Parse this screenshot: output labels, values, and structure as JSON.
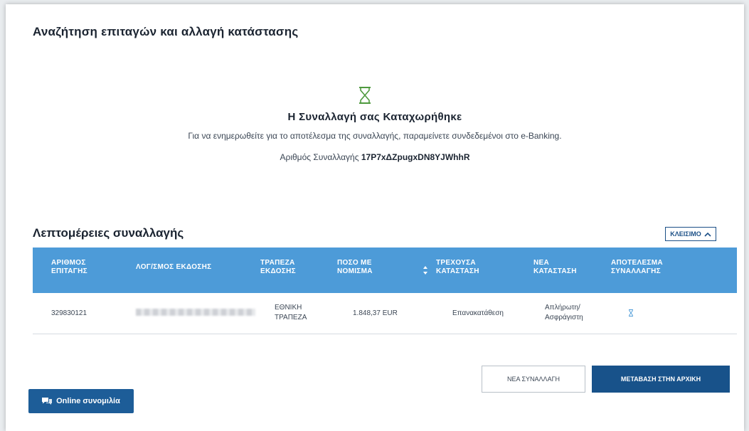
{
  "page": {
    "title": "Αναζήτηση επιταγών και αλλαγή κατάστασης"
  },
  "status": {
    "icon": "hourglass-icon",
    "heading": "Η Συναλλαγή σας Καταχωρήθηκε",
    "message": "Για να ενημερωθείτε για το αποτέλεσμα της συναλλαγής, παραμείνετε συνδεδεμένοι στο e-Banking.",
    "txn_label": "Αριθμός Συναλλαγής",
    "txn_id": "17P7xΔZpugxDN8YJWhhR",
    "accent_color": "#4f9a3f"
  },
  "details": {
    "title": "Λεπτομέρειες συναλλαγής",
    "close_label": "ΚΛΕΙΣΙΜΟ",
    "columns": [
      "ΑΡΙΘΜΟΣ ΕΠΙΤΑΓΗΣ",
      "ΛΟΓ/ΣΜΟΣ ΕΚΔΟΣΗΣ",
      "ΤΡΑΠΕΖΑ ΕΚΔΟΣΗΣ",
      "ΠΟΣΟ ΜΕ ΝΟΜΙΣΜΑ",
      "ΤΡΕΧΟΥΣΑ ΚΑΤΑΣΤΑΣΗ",
      "ΝΕΑ ΚΑΤΑΣΤΑΣΗ",
      "ΑΠΟΤΕΛΕΣΜΑ ΣΥΝΑΛΛΑΓΗΣ"
    ],
    "row": {
      "cheque_number": "329830121",
      "bank": "ΕΘΝΙΚΗ ΤΡΑΠΕΖΑ",
      "amount": "1.848,37 EUR",
      "current_status": "Επανακατάθεση",
      "new_status": "Απλήρωτη/ Ασφράγιστη",
      "result_icon": "hourglass-icon"
    },
    "header_color": "#4d9bd8"
  },
  "actions": {
    "new_transaction": "ΝΕΑ ΣΥΝΑΛΛΑΓΗ",
    "go_home": "ΜΕΤΑΒΑΣΗ ΣΤΗΝ ΑΡΧΙΚΗ",
    "chat": "Online συνομιλία",
    "primary_color": "#18528a"
  }
}
